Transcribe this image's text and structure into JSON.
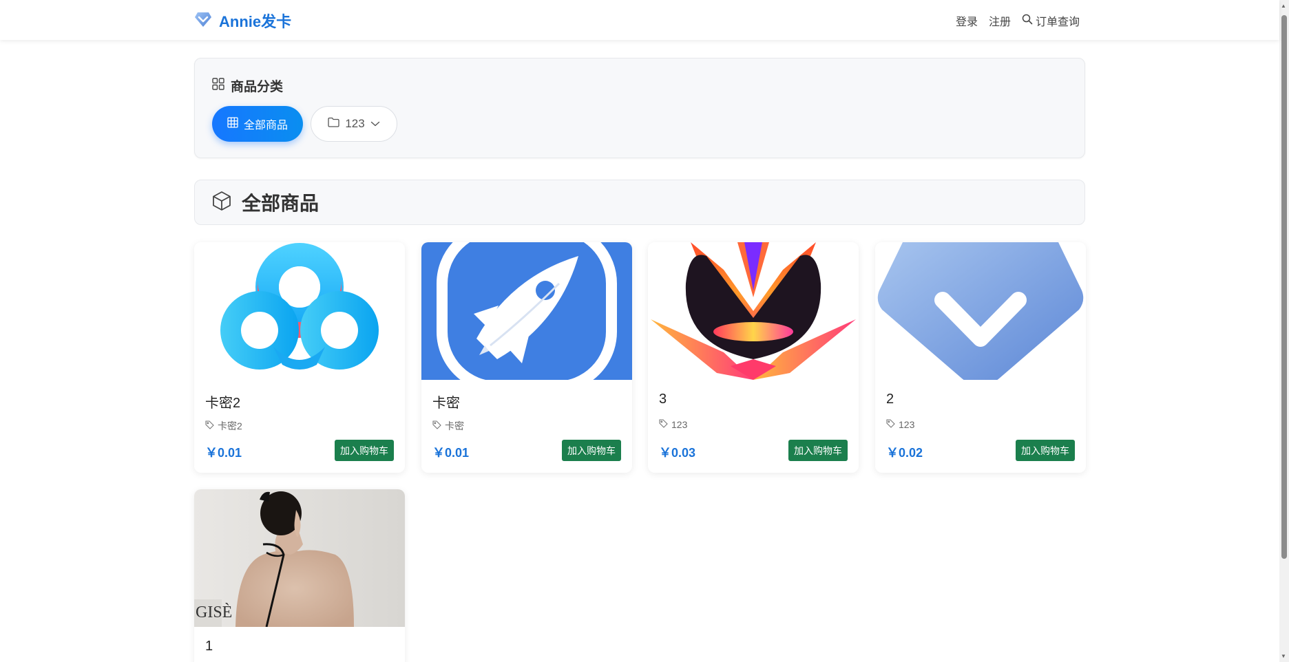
{
  "navbar": {
    "brand": "Annie发卡",
    "login": "登录",
    "register": "注册",
    "order_query": "订单查询"
  },
  "categories": {
    "title": "商品分类",
    "all_label": "全部商品",
    "dropdown_label": "123"
  },
  "section": {
    "title": "全部商品"
  },
  "products": [
    {
      "name": "卡密2",
      "tag": "卡密2",
      "price": "￥0.01",
      "button": "加入购物车"
    },
    {
      "name": "卡密",
      "tag": "卡密",
      "price": "￥0.01",
      "button": "加入购物车"
    },
    {
      "name": "3",
      "tag": "123",
      "price": "￥0.03",
      "button": "加入购物车"
    },
    {
      "name": "2",
      "tag": "123",
      "price": "￥0.02",
      "button": "加入购物车"
    },
    {
      "name": "1"
    }
  ],
  "colors": {
    "accent": "#1677ff",
    "brand": "#1a73d9",
    "cart_button": "#1b7f4d"
  },
  "image_watermark": "GISÈ"
}
